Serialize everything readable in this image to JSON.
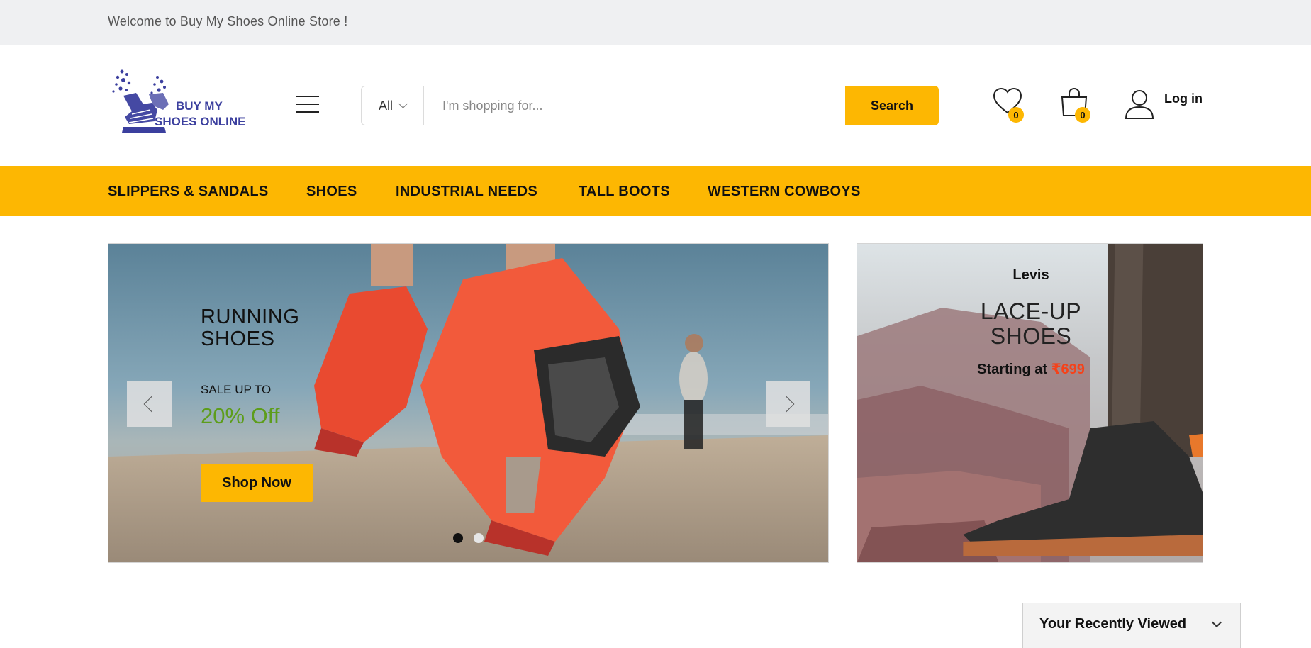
{
  "topbar": {
    "welcome": "Welcome to Buy My Shoes Online Store !"
  },
  "logo": {
    "line1": "BUY MY",
    "line2": "SHOES ONLINE"
  },
  "search": {
    "category": "All",
    "placeholder": "I'm shopping for...",
    "button": "Search"
  },
  "header_actions": {
    "wishlist_count": "0",
    "cart_count": "0",
    "login": "Log in"
  },
  "nav": {
    "items": [
      "SLIPPERS & SANDALS",
      "SHOES",
      "INDUSTRIAL NEEDS",
      "TALL BOOTS",
      "WESTERN COWBOYS"
    ]
  },
  "slider": {
    "title_line1": "RUNNING",
    "title_line2": "SHOES",
    "sale": "SALE UP TO",
    "off": "20% Off",
    "button": "Shop Now",
    "active_slide": 1,
    "slide_count": 2
  },
  "promo": {
    "brand": "Levis",
    "title_line1": "LACE-UP",
    "title_line2": "SHOES",
    "price_prefix": "Starting at",
    "price": "₹699"
  },
  "recently_viewed": {
    "label": "Your Recently Viewed"
  },
  "colors": {
    "accent": "#fdb702",
    "sale_green": "#5d9d1b",
    "price_red": "#f5421a",
    "brand_blue": "#3b3f9e"
  },
  "icons": [
    "menu-icon",
    "heart-icon",
    "shopping-bag-icon",
    "user-icon",
    "chevron-left-icon",
    "chevron-right-icon",
    "chevron-down-icon"
  ]
}
